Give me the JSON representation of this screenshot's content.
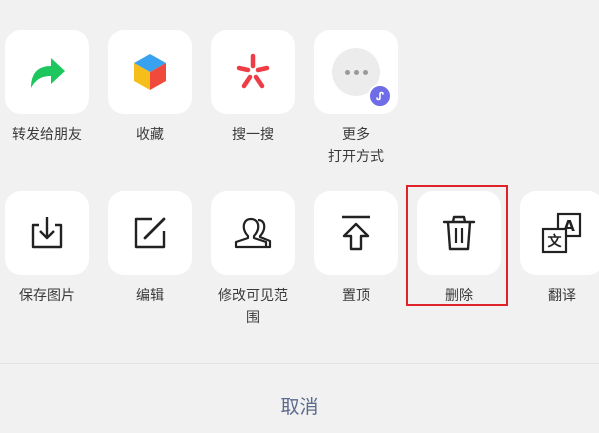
{
  "share_row": [
    {
      "label": "转发给朋友",
      "icon": "forward-arrow-icon"
    },
    {
      "label": "收藏",
      "icon": "favorite-cube-icon"
    },
    {
      "label": "搜一搜",
      "icon": "search-asterisk-icon"
    },
    {
      "label": "更多\n打开方式",
      "icon": "more-dots-icon"
    }
  ],
  "action_row": [
    {
      "label": "保存图片",
      "icon": "save-image-icon"
    },
    {
      "label": "编辑",
      "icon": "edit-icon"
    },
    {
      "label": "修改可见范\n围",
      "icon": "visibility-people-icon"
    },
    {
      "label": "置顶",
      "icon": "pin-top-icon"
    },
    {
      "label": "删除",
      "icon": "trash-icon"
    },
    {
      "label": "翻译",
      "icon": "translate-icon"
    }
  ],
  "cancel_label": "取消",
  "colors": {
    "forward_green": "#1ec75e",
    "search_red": "#ee3d45",
    "highlight_red": "#e0232b",
    "cancel_text": "#5b6a8e",
    "badge_purple": "#6f6ce8"
  }
}
